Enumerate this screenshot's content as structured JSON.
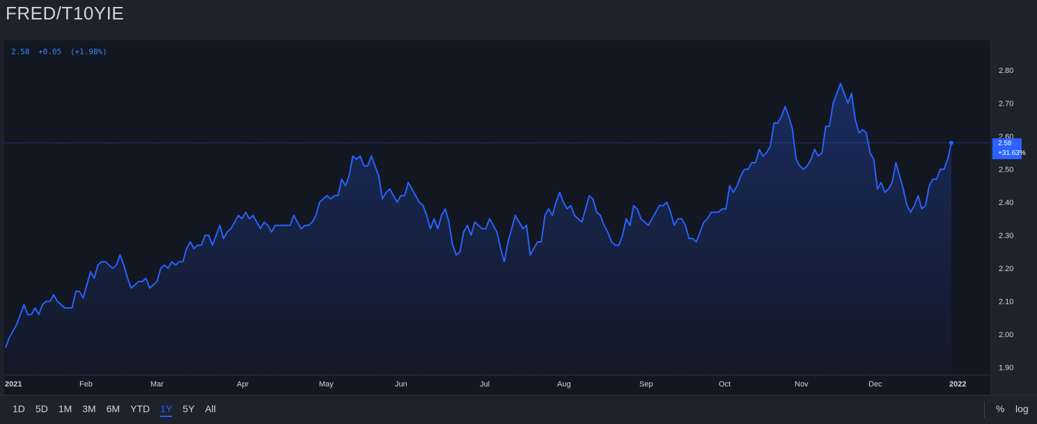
{
  "header": {
    "title": "FRED/T10YIE"
  },
  "legend": {
    "last": "2.58",
    "change": "+0.05",
    "change_pct": "(+1.98%)"
  },
  "price_badge": {
    "value": "2.58",
    "pct": "+31.63%"
  },
  "toolbar": {
    "ranges": [
      "1D",
      "5D",
      "1M",
      "3M",
      "6M",
      "YTD",
      "1Y",
      "5Y",
      "All"
    ],
    "active_range": "1Y",
    "pct_label": "%",
    "log_label": "log"
  },
  "colors": {
    "background": "#1e222d",
    "plot_background": "#131722",
    "line": "#2962ff",
    "badge": "#2962ff",
    "text": "#d1d4dc"
  },
  "chart_data": {
    "type": "area",
    "x_tick_labels": [
      "2021",
      "Feb",
      "Mar",
      "Apr",
      "May",
      "Jun",
      "Jul",
      "Aug",
      "Sep",
      "Oct",
      "Nov",
      "Dec",
      "2022"
    ],
    "y_tick_labels": [
      "1.90",
      "2.00",
      "2.10",
      "2.20",
      "2.30",
      "2.40",
      "2.50",
      "2.60",
      "2.70",
      "2.80"
    ],
    "ylim": [
      1.87,
      2.88
    ],
    "grid": false,
    "last_value": 2.58,
    "series": [
      {
        "values": [
          1.96,
          1.99,
          2.01,
          2.03,
          2.06,
          2.09,
          2.06,
          2.06,
          2.08,
          2.06,
          2.09,
          2.1,
          2.1,
          2.12,
          2.1,
          2.09,
          2.08,
          2.08,
          2.08,
          2.13,
          2.13,
          2.11,
          2.15,
          2.19,
          2.17,
          2.21,
          2.22,
          2.22,
          2.21,
          2.2,
          2.21,
          2.24,
          2.21,
          2.17,
          2.14,
          2.15,
          2.16,
          2.16,
          2.17,
          2.14,
          2.15,
          2.16,
          2.2,
          2.21,
          2.2,
          2.22,
          2.21,
          2.22,
          2.22,
          2.26,
          2.28,
          2.26,
          2.27,
          2.27,
          2.3,
          2.3,
          2.27,
          2.3,
          2.33,
          2.29,
          2.31,
          2.32,
          2.34,
          2.36,
          2.35,
          2.37,
          2.35,
          2.36,
          2.34,
          2.32,
          2.34,
          2.33,
          2.31,
          2.33,
          2.33,
          2.33,
          2.33,
          2.33,
          2.36,
          2.34,
          2.32,
          2.33,
          2.33,
          2.34,
          2.36,
          2.4,
          2.41,
          2.42,
          2.41,
          2.42,
          2.42,
          2.47,
          2.45,
          2.48,
          2.54,
          2.53,
          2.54,
          2.51,
          2.51,
          2.54,
          2.51,
          2.48,
          2.41,
          2.43,
          2.44,
          2.42,
          2.4,
          2.42,
          2.42,
          2.46,
          2.44,
          2.42,
          2.4,
          2.39,
          2.36,
          2.32,
          2.35,
          2.32,
          2.36,
          2.38,
          2.34,
          2.27,
          2.24,
          2.25,
          2.31,
          2.33,
          2.3,
          2.34,
          2.33,
          2.32,
          2.32,
          2.35,
          2.33,
          2.31,
          2.26,
          2.22,
          2.28,
          2.32,
          2.36,
          2.34,
          2.32,
          2.33,
          2.24,
          2.26,
          2.28,
          2.28,
          2.36,
          2.38,
          2.36,
          2.4,
          2.43,
          2.4,
          2.38,
          2.39,
          2.36,
          2.35,
          2.34,
          2.38,
          2.42,
          2.41,
          2.37,
          2.36,
          2.33,
          2.31,
          2.28,
          2.27,
          2.27,
          2.3,
          2.35,
          2.33,
          2.39,
          2.38,
          2.35,
          2.34,
          2.33,
          2.35,
          2.37,
          2.39,
          2.39,
          2.4,
          2.37,
          2.33,
          2.35,
          2.35,
          2.33,
          2.29,
          2.29,
          2.28,
          2.31,
          2.34,
          2.35,
          2.37,
          2.37,
          2.37,
          2.38,
          2.38,
          2.45,
          2.43,
          2.45,
          2.48,
          2.5,
          2.5,
          2.52,
          2.52,
          2.56,
          2.54,
          2.55,
          2.57,
          2.64,
          2.64,
          2.66,
          2.69,
          2.66,
          2.62,
          2.53,
          2.51,
          2.5,
          2.51,
          2.53,
          2.56,
          2.54,
          2.55,
          2.63,
          2.63,
          2.7,
          2.73,
          2.76,
          2.73,
          2.7,
          2.73,
          2.65,
          2.61,
          2.62,
          2.61,
          2.55,
          2.53,
          2.44,
          2.46,
          2.43,
          2.44,
          2.46,
          2.52,
          2.48,
          2.44,
          2.39,
          2.37,
          2.39,
          2.42,
          2.38,
          2.39,
          2.45,
          2.47,
          2.47,
          2.5,
          2.5,
          2.53,
          2.58
        ]
      }
    ]
  }
}
